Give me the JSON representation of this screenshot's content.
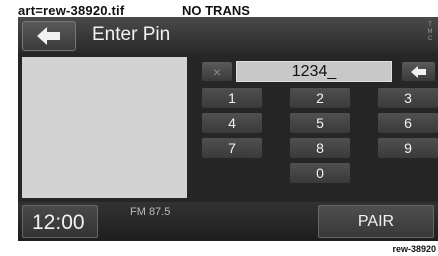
{
  "art_label": "art=rew-38920.tif",
  "trans_label": "NO TRANS",
  "screen": {
    "title": "Enter Pin",
    "corner_letters": [
      "T",
      "M",
      "C"
    ],
    "pin_value": "1234_",
    "keys": [
      "1",
      "2",
      "3",
      "4",
      "5",
      "6",
      "7",
      "8",
      "9",
      "0"
    ],
    "clear_symbol": "×",
    "clock": "12:00",
    "radio_station": "FM 87.5",
    "pair_label": "PAIR"
  },
  "reference": "rew-38920"
}
